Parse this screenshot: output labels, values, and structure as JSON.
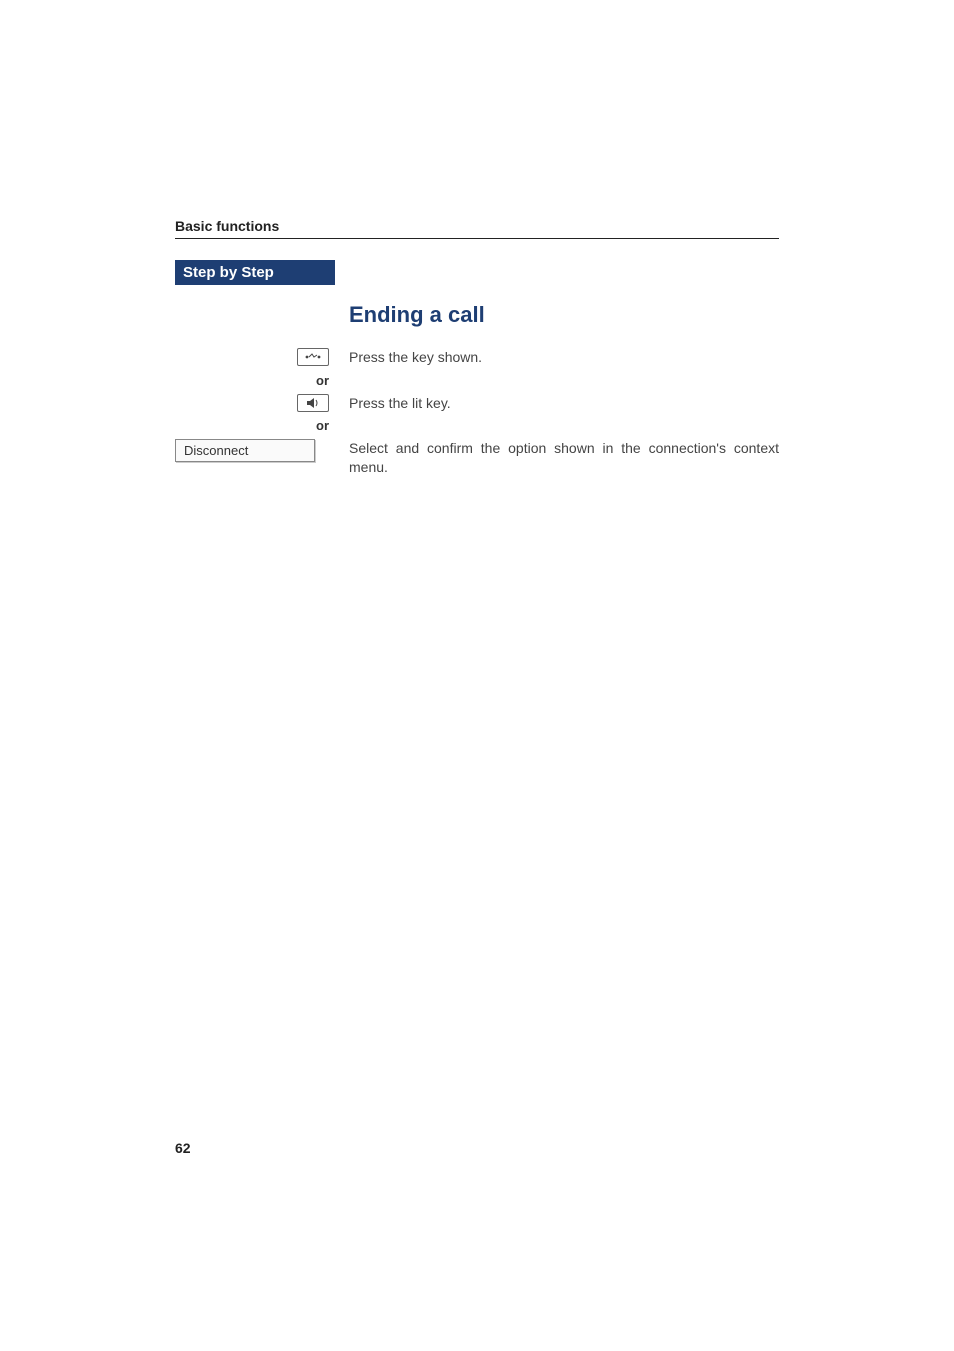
{
  "header": {
    "section_title": "Basic functions"
  },
  "sidebar": {
    "step_label": "Step by Step"
  },
  "main": {
    "heading": "Ending a call",
    "row1": {
      "icon_name": "hangup-key-icon",
      "text": "Press the key shown."
    },
    "or_label": "or",
    "row2": {
      "icon_name": "speaker-lit-key-icon",
      "text": "Press the lit key."
    },
    "row3": {
      "option_label": "Disconnect",
      "text": "Select and confirm the option shown in the connection's context menu."
    }
  },
  "footer": {
    "page_number": "62"
  }
}
